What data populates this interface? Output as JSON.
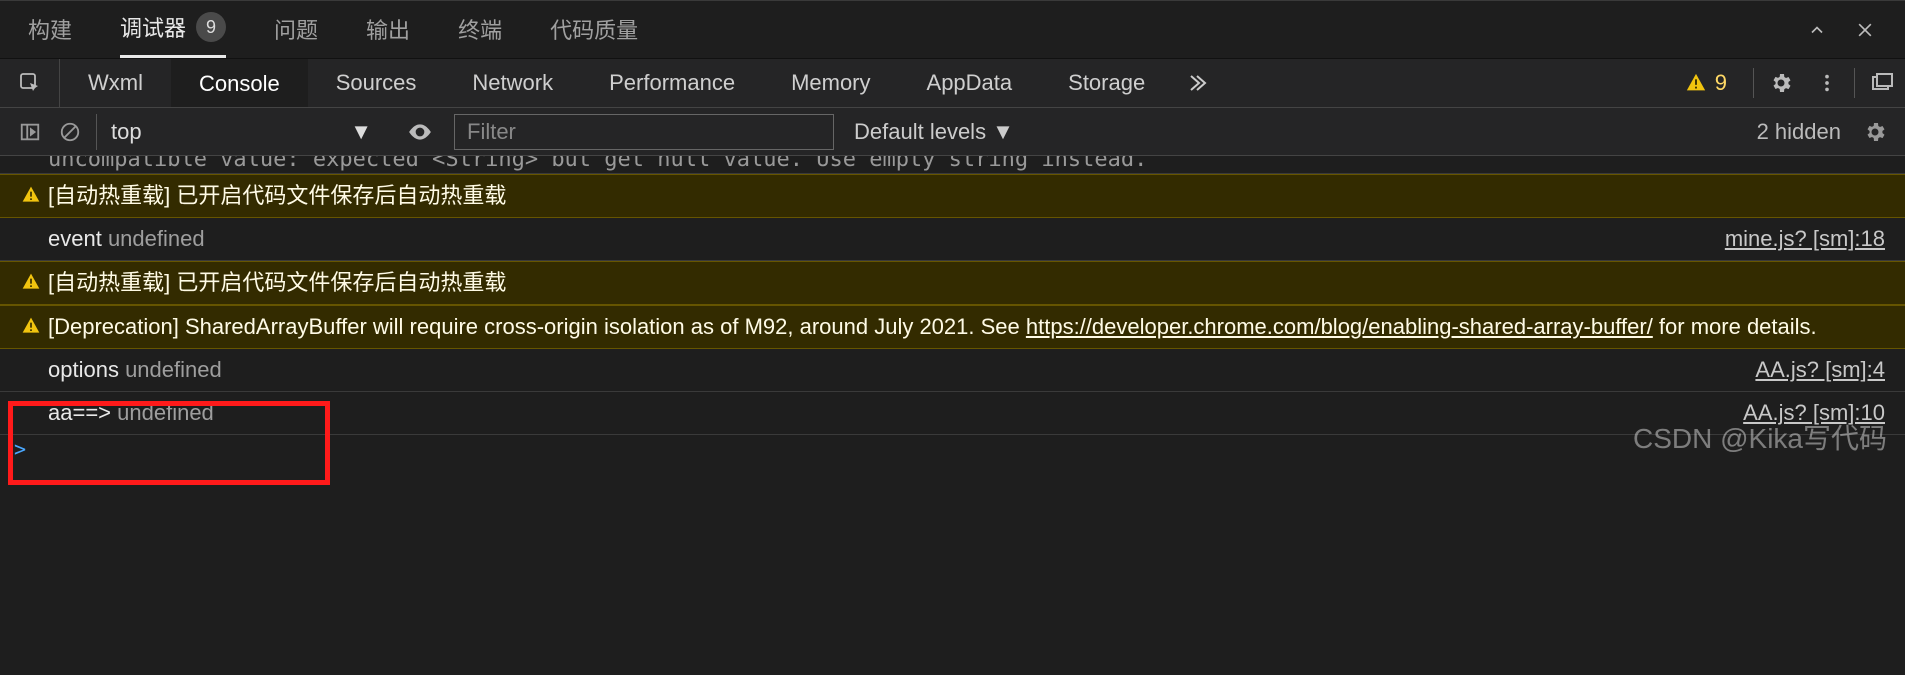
{
  "top_tabs": {
    "build": "构建",
    "debugger": "调试器",
    "debugger_badge": "9",
    "issues": "问题",
    "output": "输出",
    "terminal": "终端",
    "quality": "代码质量"
  },
  "dev_tabs": {
    "wxml": "Wxml",
    "console": "Console",
    "sources": "Sources",
    "network": "Network",
    "performance": "Performance",
    "memory": "Memory",
    "appdata": "AppData",
    "storage": "Storage"
  },
  "dev_right": {
    "warn_count": "9"
  },
  "con_toolbar": {
    "context": "top",
    "filter_placeholder": "Filter",
    "levels": "Default levels ▼",
    "hidden": "2 hidden"
  },
  "cutoff_line": "uncompatible value: expected <String> but get null value. Use empty string instead.",
  "logs": [
    {
      "type": "warn",
      "msg_a": "[自动热重载]",
      "msg_b": " 已开启代码文件保存后自动热重载"
    },
    {
      "type": "log",
      "msg_a": "event ",
      "msg_b": "undefined",
      "src": "mine.js? [sm]:18"
    },
    {
      "type": "warn",
      "msg_a": "[自动热重载]",
      "msg_b": " 已开启代码文件保存后自动热重载"
    },
    {
      "type": "warn_dep",
      "part1": "[Deprecation] SharedArrayBuffer will require cross-origin isolation as of M92, around July 2021. See ",
      "link": "https://developer.chrome.com/blog/enabling-shared-array-buffer/",
      "part2": " for more details."
    },
    {
      "type": "log",
      "msg_a": "options ",
      "msg_b": "undefined",
      "src": "AA.js? [sm]:4"
    },
    {
      "type": "log",
      "msg_a": "aa==> ",
      "msg_b": "undefined",
      "src": "AA.js? [sm]:10"
    }
  ],
  "watermark": "CSDN @Kika写代码"
}
